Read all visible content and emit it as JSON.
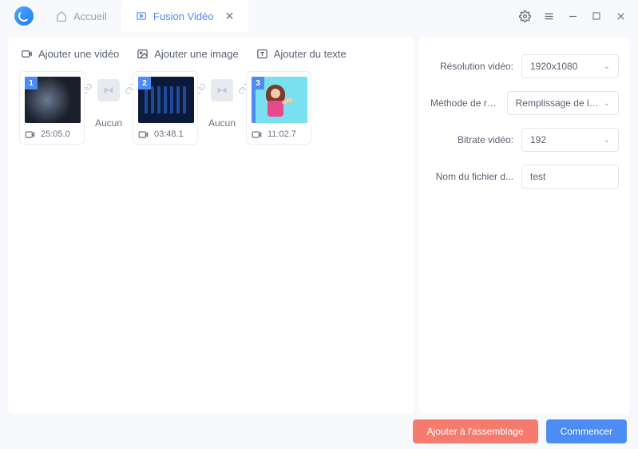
{
  "tabs": {
    "home": "Accueil",
    "merge": "Fusion Vidéo"
  },
  "toolbar": {
    "add_video": "Ajouter une vidéo",
    "add_image": "Ajouter une image",
    "add_text": "Ajouter du texte"
  },
  "clips": [
    {
      "index": "1",
      "duration": "25:05.0"
    },
    {
      "index": "2",
      "duration": "03:48.1"
    },
    {
      "index": "3",
      "duration": "11:02.7"
    }
  ],
  "transition": {
    "none": "Aucun"
  },
  "settings": {
    "resolution": {
      "label": "Résolution vidéo:",
      "value": "1920x1080"
    },
    "fill": {
      "label": "Méthode de rem...",
      "value": "Remplissage de la bord"
    },
    "bitrate": {
      "label": "Bitrate vidéo:",
      "value": "192"
    },
    "filename": {
      "label": "Nom du fichier d...",
      "value": "test"
    }
  },
  "footer": {
    "assemble": "Ajouter à l'assemblage",
    "start": "Commencer"
  }
}
